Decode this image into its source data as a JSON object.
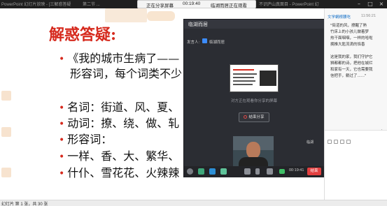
{
  "topbar": {
    "app_title": "PowerPoint 幻灯片放映 - [三解惑答疑",
    "tab_label": "第二节 ...",
    "right_title": "不识庐山真面目 - PowerPoint 幻"
  },
  "share_bar": {
    "status": "正在分享屏幕",
    "timer": "00:19:40",
    "room": "临湖而居正在观看"
  },
  "slide": {
    "title": "解惑答疑:",
    "lines": [
      "《我的城市生病了——",
      "形容词，每个词类不少",
      "名词：街道、风、夏、",
      "动词：撩、绕、做、轧",
      "形容词：",
      "一样、香、大、繁华、",
      "什仆、雪花花、火辣辣"
    ]
  },
  "meeting": {
    "title": "临湖而居",
    "speaker_label": "发言人:",
    "speaker_name": "临湖而居",
    "share_hint": "对方正在观看你分享的屏幕",
    "stop_share": "结束分享",
    "video_label": "临湖",
    "time": "00:19:41",
    "end_button": "结束"
  },
  "chat": {
    "sender": "文学蜗根腰吃",
    "time": "11:56:21",
    "lines": [
      "\"街道的风，撩醒了熟",
      "竹床上的小孩儿做着梦",
      "热干面咽咽，一样的哈啦",
      "拥推大匙流滴的馅香",
      "",
      "这是我的家，我们守护它",
      "狮都都的诗，把他在城烂",
      "和家有一天，它也需要我",
      "信把手，躺过了......\""
    ]
  },
  "statusbar": {
    "slide_counter": "幻灯片 第 1 张，共 30 张"
  },
  "colors": {
    "title_red": "#d62a1e",
    "end_red": "#e34040",
    "chat_blue": "#1a73c8"
  }
}
